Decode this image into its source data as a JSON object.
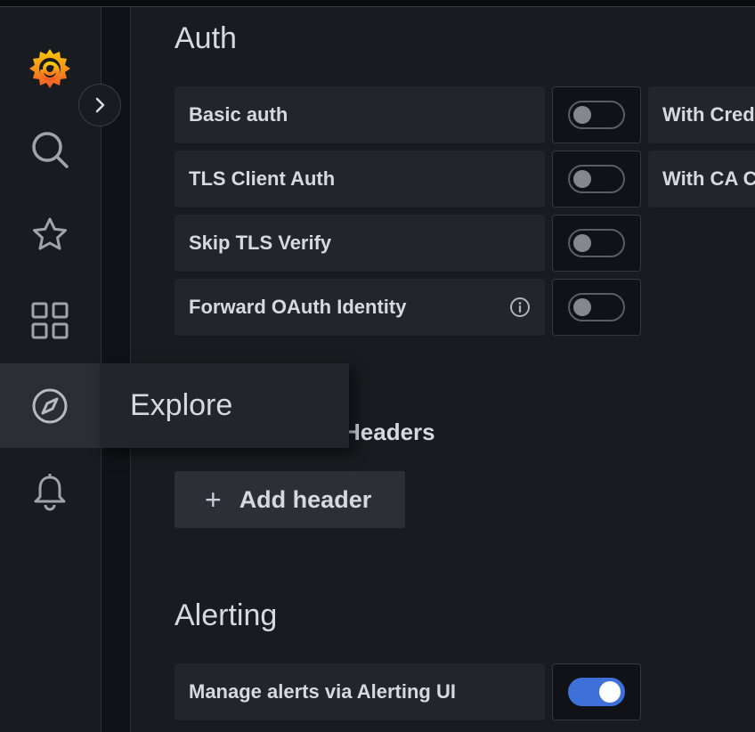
{
  "nav": {
    "items": [
      {
        "icon": "grafana-logo-icon"
      },
      {
        "icon": "search-icon"
      },
      {
        "icon": "star-icon"
      },
      {
        "icon": "dashboards-grid-icon"
      },
      {
        "icon": "compass-icon"
      },
      {
        "icon": "bell-icon"
      }
    ],
    "tooltip": "Explore"
  },
  "auth": {
    "title": "Auth",
    "rows": [
      {
        "label": "Basic auth",
        "enabled": false,
        "right_label": "With Credentials"
      },
      {
        "label": "TLS Client Auth",
        "enabled": false,
        "right_label": "With CA Cert"
      },
      {
        "label": "Skip TLS Verify",
        "enabled": false
      },
      {
        "label": "Forward OAuth Identity",
        "enabled": false,
        "info": "info-icon"
      }
    ]
  },
  "headers": {
    "title": "Headers",
    "add_label": "Add header"
  },
  "alerting": {
    "title": "Alerting",
    "rows": [
      {
        "label": "Manage alerts via Alerting UI",
        "enabled": true
      }
    ]
  },
  "colors": {
    "background": "#181b1f",
    "panel": "#22252b",
    "toggle_on": "#3d71d9",
    "logo": "#f46800"
  }
}
